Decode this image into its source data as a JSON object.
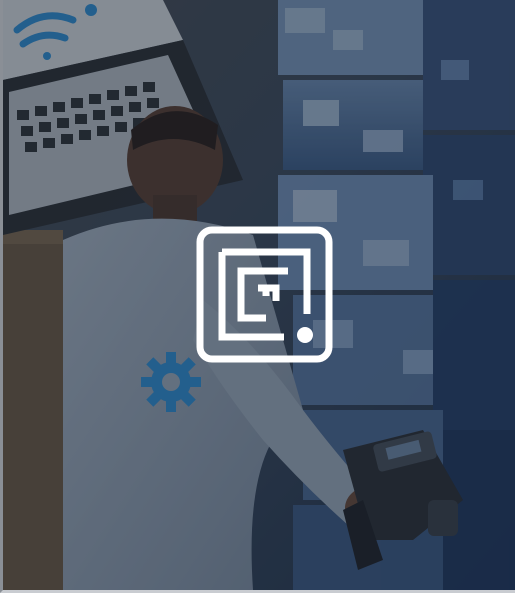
{
  "hero": {
    "image_subject": "warehouse-worker-scanning-boxes",
    "overlay_color": "#141c28",
    "logo_icon": "scan-frame-logo-icon",
    "logo_color": "#ffffff",
    "wifi_icon": "wifi-icon",
    "gear_icon": "gear-icon",
    "accent_color": "#2f8fd6"
  }
}
